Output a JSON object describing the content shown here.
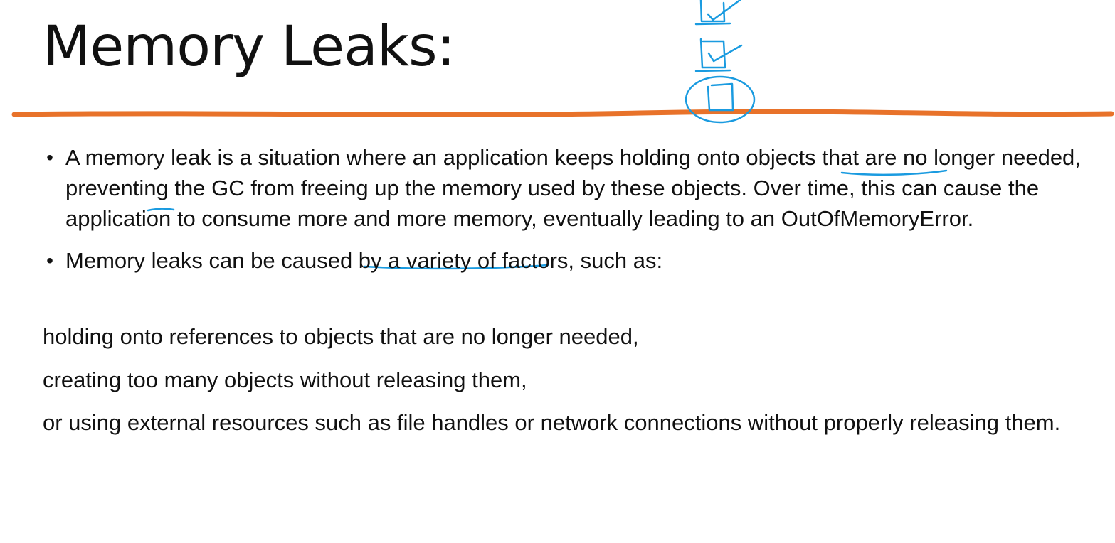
{
  "slide": {
    "title": "Memory Leaks:",
    "bullets": [
      {
        "text": "A memory leak is a situation where an application keeps holding onto objects that are no longer needed, preventing the GC from freeing up the memory used by these objects. Over time, this can cause the application to consume more and more memory, eventually leading to an OutOfMemoryError."
      },
      {
        "text": "Memory leaks can be caused by a variety of factors, such as:"
      }
    ],
    "paragraphs": [
      "holding onto references to objects that are no longer needed,",
      "creating too many objects without releasing them,",
      "or using external resources such as file handles or network connections without properly releasing them."
    ],
    "bullet_glyph": "•"
  },
  "colors": {
    "divider": "#e8722a",
    "ink": "#1a9be0",
    "text": "#111111",
    "background": "#ffffff"
  }
}
